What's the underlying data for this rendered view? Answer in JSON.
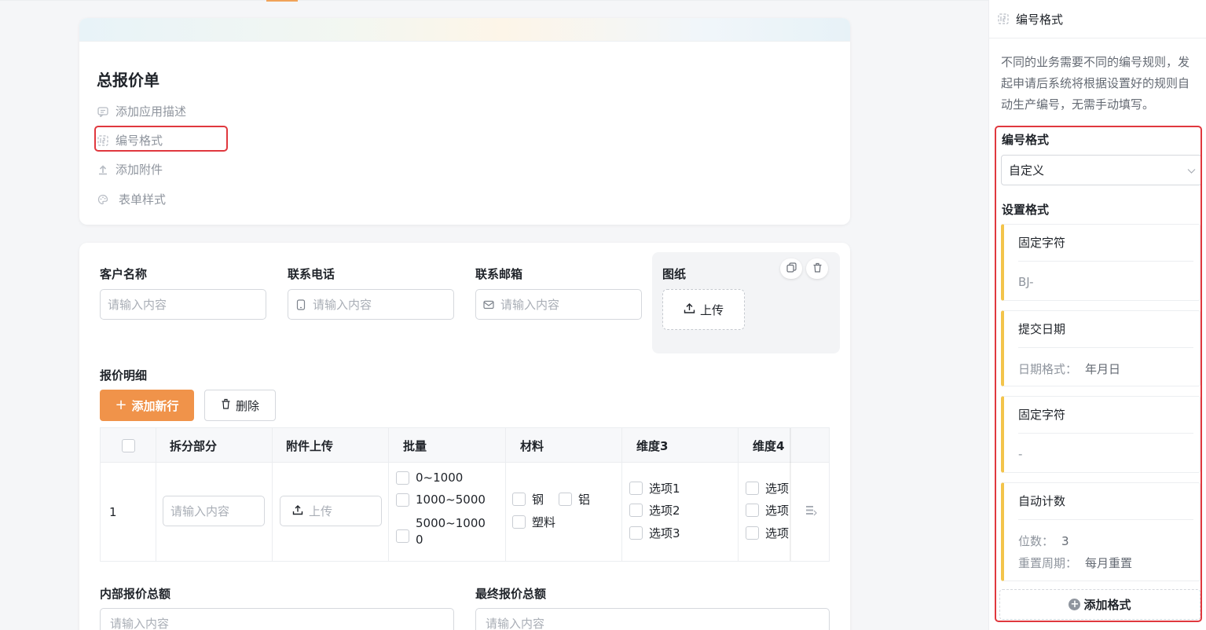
{
  "header": {
    "title": "总报价单",
    "links": [
      {
        "label": "添加应用描述",
        "icon": "comment-icon"
      },
      {
        "label": "编号格式",
        "icon": "number-format-icon"
      },
      {
        "label": "添加附件",
        "icon": "upload-icon"
      },
      {
        "label": "表单样式",
        "icon": "palette-icon"
      }
    ]
  },
  "form": {
    "fields": [
      {
        "label": "客户名称",
        "placeholder": "请输入内容"
      },
      {
        "label": "联系电话",
        "placeholder": "请输入内容",
        "icon": "phone-icon"
      },
      {
        "label": "联系邮箱",
        "placeholder": "请输入内容",
        "icon": "mail-icon"
      }
    ],
    "drawing": {
      "label": "图纸",
      "upload_label": "上传"
    },
    "detail": {
      "label": "报价明细",
      "add_row": "添加新行",
      "delete": "删除",
      "columns": [
        "拆分部分",
        "附件上传",
        "批量",
        "材料",
        "维度3",
        "维度4"
      ],
      "row": {
        "index": "1",
        "split_placeholder": "请输入内容",
        "upload_label": "上传",
        "batch_options": [
          "0~1000",
          "1000~5000",
          "5000~1000",
          "0"
        ],
        "material_options": [
          "钢",
          "铝",
          "塑料"
        ],
        "dim3_options": [
          "选项1",
          "选项2",
          "选项3"
        ],
        "dim4_options": [
          "选项",
          "选项",
          "选项"
        ]
      }
    },
    "totals": [
      {
        "label": "内部报价总额",
        "placeholder": "请输入内容"
      },
      {
        "label": "最终报价总额",
        "placeholder": "请输入内容"
      }
    ]
  },
  "side_panel": {
    "title": "编号格式",
    "description": "不同的业务需要不同的编号规则，发起申请后系统将根据设置好的规则自动生产编号，无需手动填写。",
    "format_label": "编号格式",
    "format_value": "自定义",
    "set_format_label": "设置格式",
    "rules": [
      {
        "title": "固定字符",
        "value": "BJ-"
      },
      {
        "title": "提交日期",
        "value_label": "日期格式：",
        "value": "年月日"
      },
      {
        "title": "固定字符",
        "value": "-"
      },
      {
        "title": "自动计数",
        "digits_label": "位数：",
        "digits": "3",
        "reset_label": "重置周期：",
        "reset": "每月重置"
      }
    ],
    "add_format": "添加格式",
    "accent_color": "#f3c44b",
    "highlight_color": "#e0383e"
  },
  "colors": {
    "primary_button": "#f0934a"
  }
}
